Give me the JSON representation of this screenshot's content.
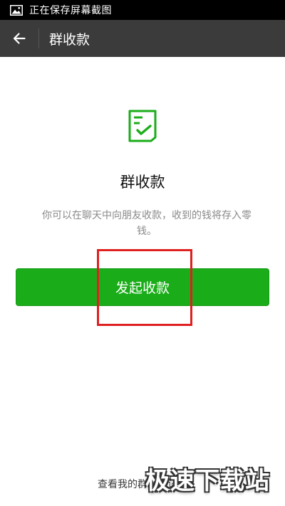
{
  "status_bar": {
    "text": "正在保存屏幕截图",
    "icon": "image-icon"
  },
  "header": {
    "title": "群收款",
    "back_icon": "back-arrow-icon"
  },
  "main": {
    "icon": "receipt-check-icon",
    "heading": "群收款",
    "description": "你可以在聊天中向朋友收款，收到的钱将存入零钱。",
    "button_label": "发起收款",
    "footer_link": "查看我的群收款记录"
  },
  "watermark": {
    "text": "极速下载站"
  },
  "colors": {
    "status_bar_bg": "#000000",
    "header_bg": "#3b3b3b",
    "accent_green": "#1aad19",
    "highlight_red": "#e02020",
    "description_gray": "#8a8a8a"
  }
}
